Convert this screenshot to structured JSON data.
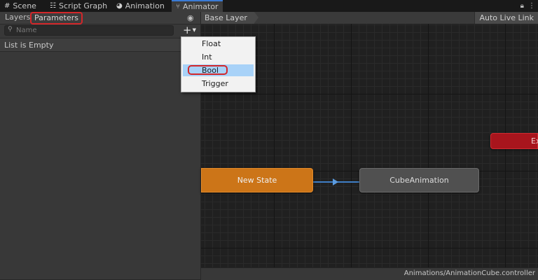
{
  "tabs": [
    {
      "label": "Scene",
      "icon": "grid-icon"
    },
    {
      "label": "Script Graph",
      "icon": "hierarchy-icon"
    },
    {
      "label": "Animation",
      "icon": "play-circle-icon"
    },
    {
      "label": "Animator",
      "icon": "animator-icon"
    }
  ],
  "left_panel": {
    "tab_layers": "Layers",
    "tab_parameters": "Parameters",
    "search_placeholder": "Name",
    "add_button": "+",
    "empty_text": "List is Empty"
  },
  "graph": {
    "breadcrumb": "Base Layer",
    "auto_live_link": "Auto Live Link",
    "states": {
      "new_state": "New State",
      "cube_animation": "CubeAnimation",
      "exit": "Ex"
    },
    "status_path": "Animations/AnimationCube.controller"
  },
  "dropdown": {
    "items": [
      "Float",
      "Int",
      "Bool",
      "Trigger"
    ],
    "selected": "Bool"
  },
  "colors": {
    "highlight_red": "#d3272a",
    "state_orange": "#cc7518",
    "state_gray": "#505050",
    "exit_red": "#a8151d",
    "selection_blue": "#a8d2f8"
  }
}
